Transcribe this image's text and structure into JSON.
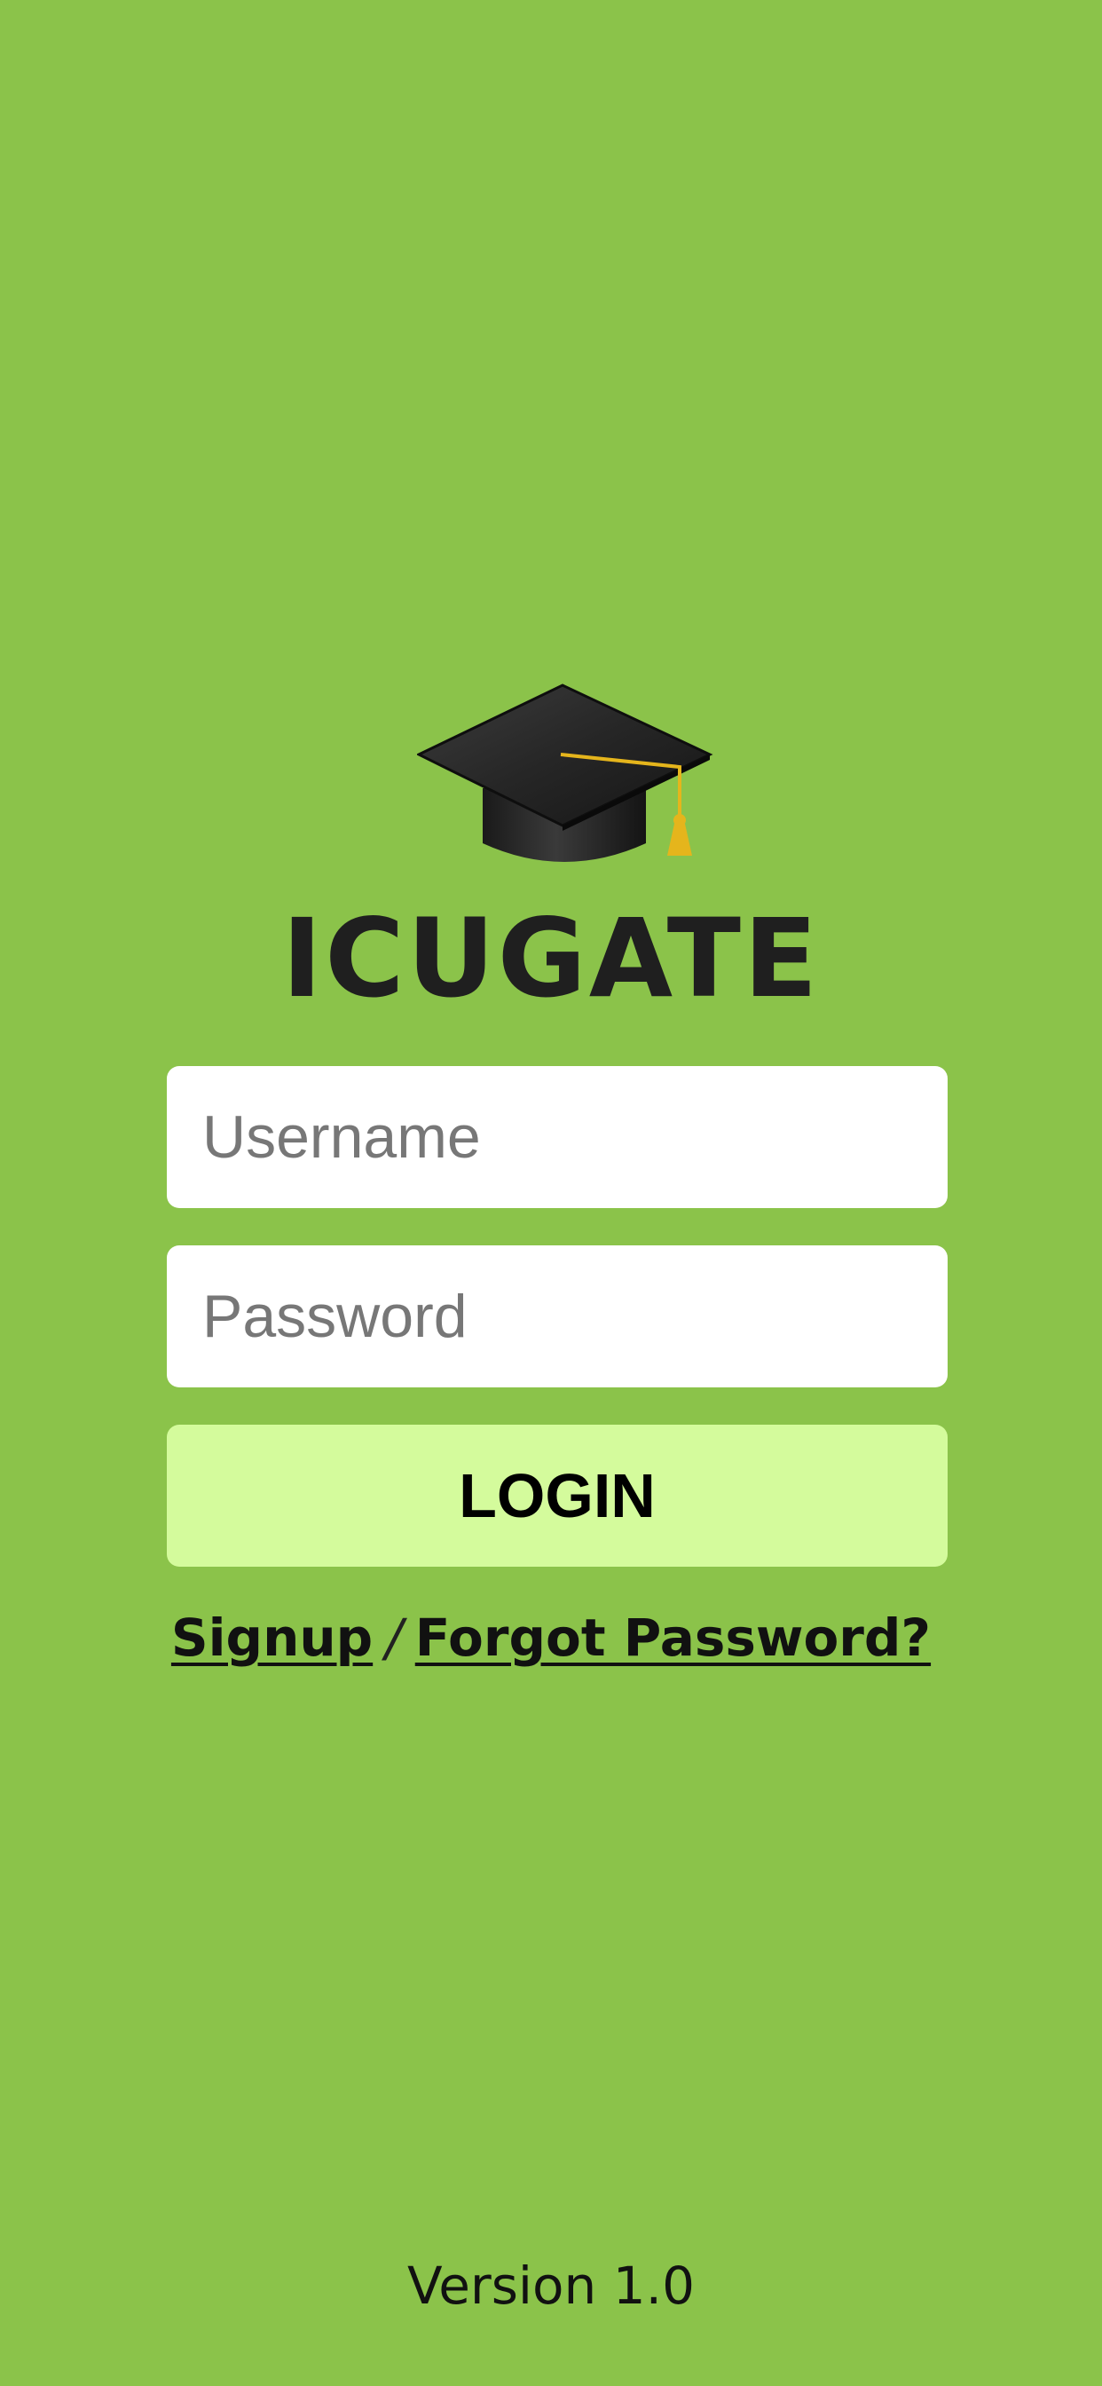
{
  "app": {
    "brand_name": "ICUGATE",
    "logo_icon": "graduation-cap-icon"
  },
  "login_form": {
    "username_placeholder": "Username",
    "username_value": "",
    "password_placeholder": "Password",
    "password_value": "",
    "login_label": "LOGIN"
  },
  "links": {
    "signup_label": "Signup",
    "separator": "/",
    "forgot_label": "Forgot Password?"
  },
  "footer": {
    "version_label": "Version 1.0"
  },
  "colors": {
    "background": "#8bc34a",
    "login_button": "#d4fb9c",
    "input_background": "#ffffff",
    "tassel": "#e5b51c"
  }
}
